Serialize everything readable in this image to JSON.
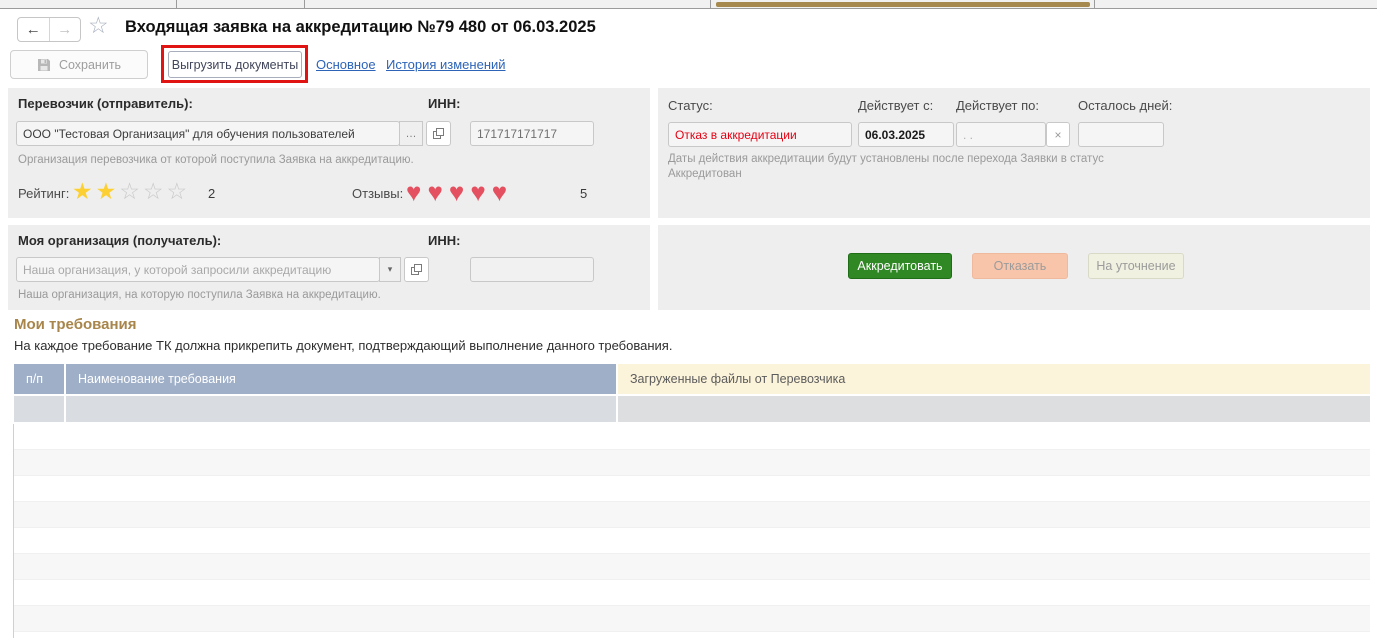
{
  "window": {
    "title": "Входящая заявка на аккредитацию №79 480 от 06.03.2025"
  },
  "toolbar": {
    "save_label": "Сохранить",
    "upload_docs_label": "Выгрузить документы",
    "nav_links": [
      {
        "label": "Основное"
      },
      {
        "label": "История изменений"
      }
    ]
  },
  "carrier_panel": {
    "label": "Перевозчик (отправитель):",
    "value": "ООО \"Тестовая Организация\" для обучения пользователей",
    "lookup_button": "…",
    "inn_label": "ИНН:",
    "inn_value": "171717171717",
    "hint": "Организация перевозчика от которой поступила Заявка на аккредитацию.",
    "rating_label": "Рейтинг:",
    "rating_value": "2",
    "rating_max": 5,
    "reviews_label": "Отзывы:",
    "reviews_value": "5",
    "reviews_max": 5
  },
  "status_panel": {
    "status_label": "Статус:",
    "status_value": "Отказ в аккредитации",
    "valid_from_label": "Действует с:",
    "valid_from_value": "06.03.2025",
    "valid_to_label": "Действует по:",
    "valid_to_placeholder": ". .",
    "clear_button": "×",
    "days_left_label": "Осталось дней:",
    "days_left_value": "",
    "hint": "Даты действия аккредитации будут установлены после перехода Заявки в статус Аккредитован"
  },
  "my_org_panel": {
    "label": "Моя организация (получатель):",
    "placeholder": "Наша организация, у которой запросили аккредитацию",
    "inn_label": "ИНН:",
    "inn_value": "",
    "hint": "Наша организация, на которую поступила Заявка на аккредитацию."
  },
  "actions": {
    "accredit_label": "Аккредитовать",
    "reject_label": "Отказать",
    "clarify_label": "На уточнение"
  },
  "requirements": {
    "title": "Мои требования",
    "subtitle": "На каждое требование ТК должна прикрепить документ, подтверждающий выполнение данного требования.",
    "columns": [
      "п/п",
      "Наименование требования",
      "Загруженные файлы от Перевозчика"
    ],
    "rows": []
  },
  "colors": {
    "status_red": "#e60012",
    "annotation_red": "#e11414",
    "accredit_green": "#2f8824",
    "reject_salmon": "#f8c5aa",
    "heading_gold": "#a8854a",
    "table_header_blue": "#9fafc8",
    "table_header_cream": "#fcf4da",
    "active_tab_gold": "#a6894f",
    "star_gold": "#fccf33",
    "heart_red": "#e4505f",
    "link_blue": "#2d64b8"
  }
}
